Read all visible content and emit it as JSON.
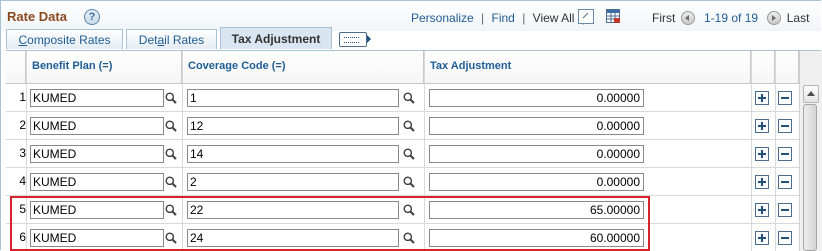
{
  "header": {
    "title": "Rate Data",
    "help_glyph": "?",
    "links": {
      "personalize": "Personalize",
      "find": "Find",
      "view_all": "View All",
      "separator": "|"
    },
    "pager": {
      "first": "First",
      "range": "1-19 of 19",
      "last": "Last"
    }
  },
  "tabs": [
    {
      "label_u": "C",
      "label_rest": "omposite Rates",
      "active": false
    },
    {
      "label_pre": "Det",
      "label_u": "a",
      "label_rest": "il Rates",
      "active": false
    },
    {
      "label": "Tax Adjustment",
      "active": true
    }
  ],
  "columns": {
    "benefit_plan": "Benefit Plan (=)",
    "coverage_code": "Coverage Code (=)",
    "tax_adjustment": "Tax Adjustment"
  },
  "rows": [
    {
      "num": "1",
      "benefit_plan": "KUMED",
      "coverage_code": "1",
      "tax_adjustment": "0.00000"
    },
    {
      "num": "2",
      "benefit_plan": "KUMED",
      "coverage_code": "12",
      "tax_adjustment": "0.00000"
    },
    {
      "num": "3",
      "benefit_plan": "KUMED",
      "coverage_code": "14",
      "tax_adjustment": "0.00000"
    },
    {
      "num": "4",
      "benefit_plan": "KUMED",
      "coverage_code": "2",
      "tax_adjustment": "0.00000"
    },
    {
      "num": "5",
      "benefit_plan": "KUMED",
      "coverage_code": "22",
      "tax_adjustment": "65.00000"
    },
    {
      "num": "6",
      "benefit_plan": "KUMED",
      "coverage_code": "24",
      "tax_adjustment": "60.00000"
    }
  ],
  "icons": {
    "help": "help-icon",
    "zoom": "zoom-icon",
    "download": "grid-download-icon",
    "show_all_columns": "show-all-columns-icon",
    "lookup": "magnifier-icon",
    "add_row": "add-row-icon",
    "delete_row": "delete-row-icon"
  },
  "colors": {
    "title": "#8a4a1f",
    "link": "#1f5d95",
    "highlight_box": "#d6242a"
  }
}
